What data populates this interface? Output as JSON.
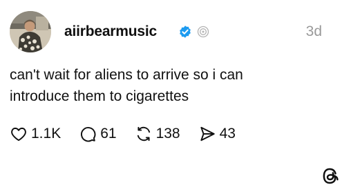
{
  "post": {
    "username": "aiirbearmusic",
    "time": "3d",
    "text_line1": "can't wait for aliens to arrive so i can",
    "text_line2": "introduce them to cigarettes",
    "actions": {
      "likes": "1.1K",
      "replies": "61",
      "reposts": "138",
      "shares": "43"
    }
  },
  "colors": {
    "verified": "#1d9bf0",
    "muted": "#999999",
    "text": "#101010"
  },
  "icons": {
    "verified": "verified-badge-icon",
    "threads_badge": "threads-badge-icon",
    "like": "heart-icon",
    "reply": "comment-icon",
    "repost": "repost-icon",
    "share": "send-icon",
    "logo": "threads-logo-icon"
  }
}
